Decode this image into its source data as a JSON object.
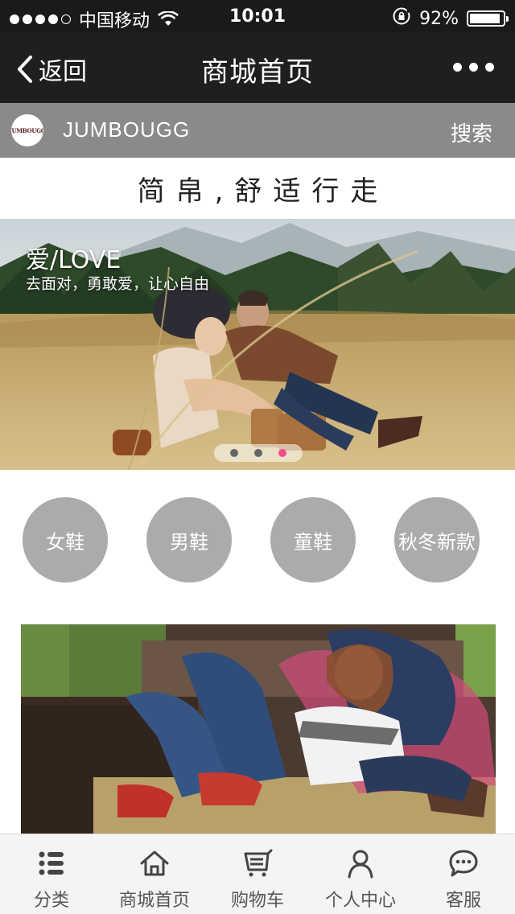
{
  "status_bar": {
    "carrier": "中国移动",
    "time": "10:01",
    "battery_text": "92%",
    "battery_level": 0.92
  },
  "nav": {
    "back_label": "返回",
    "title": "商城首页"
  },
  "brand": {
    "logo_text": "JUMBOUGG",
    "name": "JUMBOUGG",
    "search_label": "搜索"
  },
  "slogan": "简帛,舒适行走",
  "banner": {
    "title": "爱/LOVE",
    "subtitle": "去面对，勇敢爱，让心自由",
    "slide_count": 3,
    "active_slide": 3
  },
  "categories": [
    {
      "label": "女鞋"
    },
    {
      "label": "男鞋"
    },
    {
      "label": "童鞋"
    },
    {
      "label": "秋冬新款"
    }
  ],
  "tabbar": [
    {
      "label": "分类",
      "icon": "list-icon"
    },
    {
      "label": "商城首页",
      "icon": "home-icon"
    },
    {
      "label": "购物车",
      "icon": "cart-icon"
    },
    {
      "label": "个人中心",
      "icon": "user-icon"
    },
    {
      "label": "客服",
      "icon": "chat-icon"
    }
  ],
  "colors": {
    "status_bg": "#1a1a1c",
    "nav_bg": "#1f1f21",
    "brand_bar_bg": "#8a8a8a",
    "category_circle": "#ababab",
    "indicator_active": "#f0508a",
    "tabbar_bg": "#f4f4f4"
  }
}
